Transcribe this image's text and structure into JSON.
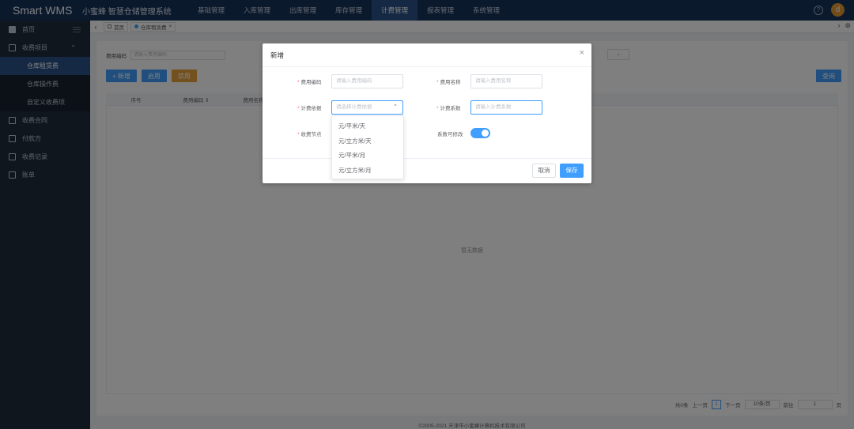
{
  "header": {
    "brand": "Smart WMS",
    "subtitle": "小蜜蜂 智慧仓储管理系统",
    "nav": [
      "基础管理",
      "入库管理",
      "出库管理",
      "库存管理",
      "计费管理",
      "报表管理",
      "系统管理"
    ],
    "active_nav": "计费管理",
    "help_glyph": "?",
    "avatar_letter": "d"
  },
  "sidebar": {
    "items": [
      {
        "label": "首页",
        "icon": "dashboard-icon"
      },
      {
        "label": "收费项目",
        "icon": "fee-item-icon"
      },
      {
        "label": "仓库租赁费",
        "sub": true,
        "active": true
      },
      {
        "label": "仓库操作费",
        "sub": true
      },
      {
        "label": "自定义收费项",
        "sub": true
      },
      {
        "label": "收费合同",
        "icon": "contract-icon"
      },
      {
        "label": "付款方",
        "icon": "payer-icon"
      },
      {
        "label": "收费记录",
        "icon": "record-icon"
      },
      {
        "label": "账单",
        "icon": "bill-icon"
      }
    ]
  },
  "tabs": {
    "home": "首页",
    "current": "仓库租赁费"
  },
  "main": {
    "search_label": "费用编码",
    "search_placeholder": "请输入费用编码",
    "btn_add": "+ 新增",
    "btn_enable": "启用",
    "btn_disable": "禁用",
    "btn_query": "查询",
    "columns": [
      "序号",
      "费用编码 ⇕",
      "费用名称 ⇕"
    ],
    "empty_text": "暂无数据",
    "pager": {
      "total": "共0条",
      "prev": "上一页",
      "page": "1",
      "next": "下一页",
      "page_size": "10条/页",
      "goto_label": "前往",
      "goto_value": "1",
      "goto_suffix": "页"
    },
    "footer": "©2005-2021 天津市小蜜蜂计算机技术有限公司"
  },
  "dialog": {
    "title": "新增",
    "code_label": "费用编码",
    "code_placeholder": "请输入费用编码",
    "name_label": "费用名称",
    "name_placeholder": "请输入费用名称",
    "basis_label": "计费依据",
    "basis_placeholder": "请选择计费依据",
    "coef_label": "计费系数",
    "coef_placeholder": "请输入计费系数",
    "node_label": "收费节点",
    "editable_label": "系数可修改",
    "editable_on": true,
    "cancel": "取消",
    "save": "保存"
  },
  "dropdown": {
    "options": [
      "元/平米/天",
      "元/立方米/天",
      "元/平米/月",
      "元/立方米/月"
    ]
  },
  "colors": {
    "topbar": "#17325a",
    "sidebar": "#1f2d3d",
    "primary": "#409eff",
    "warning": "#e6a23c",
    "required": "#f56c6c"
  }
}
